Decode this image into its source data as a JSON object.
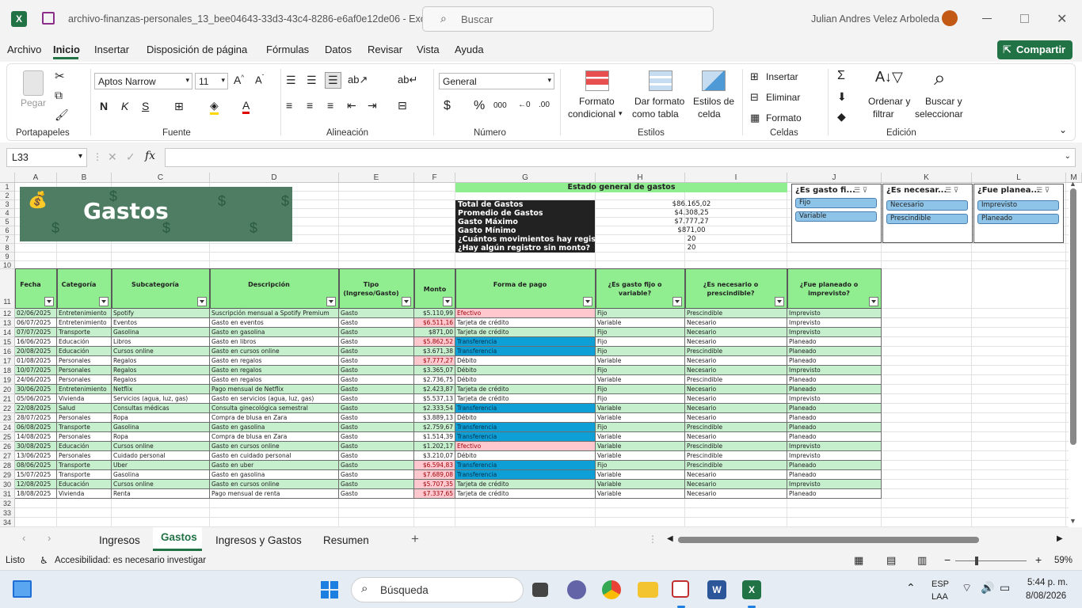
{
  "window": {
    "title": "archivo-finanzas-personales_13_bee04643-33d3-43c4-8286-e6af0e12de06  -  Excel",
    "search_placeholder": "Buscar",
    "user": "Julian Andres Velez Arboleda"
  },
  "menu": [
    "Archivo",
    "Inicio",
    "Insertar",
    "Disposición de página",
    "Fórmulas",
    "Datos",
    "Revisar",
    "Vista",
    "Ayuda"
  ],
  "share_label": "Compartir",
  "ribbon": {
    "groups": [
      "Portapapeles",
      "Fuente",
      "Alineación",
      "Número",
      "Estilos",
      "Celdas",
      "Edición"
    ],
    "paste_label": "Pegar",
    "font_name": "Aptos Narrow",
    "font_size": "11",
    "number_format": "General",
    "cond_format": [
      "Formato",
      "condicional"
    ],
    "format_table": [
      "Dar formato",
      "como tabla"
    ],
    "cell_styles": [
      "Estilos de",
      "celda"
    ],
    "insert": "Insertar",
    "delete": "Eliminar",
    "format": "Formato",
    "sort_filter": [
      "Ordenar y",
      "filtrar"
    ],
    "find_select": [
      "Buscar y",
      "seleccionar"
    ]
  },
  "formula_bar": {
    "name_box": "L33",
    "formula": ""
  },
  "columns": [
    "A",
    "B",
    "C",
    "D",
    "E",
    "F",
    "G",
    "H",
    "I",
    "J",
    "K",
    "L",
    "M"
  ],
  "rows": [
    "1",
    "2",
    "3",
    "4",
    "5",
    "6",
    "7",
    "8",
    "9",
    "10",
    "11",
    "12",
    "13",
    "14",
    "15",
    "16",
    "17",
    "18",
    "19",
    "20",
    "21",
    "22",
    "23",
    "24",
    "25",
    "26",
    "27",
    "28",
    "29",
    "30",
    "31",
    "32",
    "33",
    "34"
  ],
  "banner_title": "Gastos",
  "summary": {
    "title": "Estado general de gastos",
    "labels": [
      "Total de Gastos",
      "Promedio de Gastos",
      "Gasto Máximo",
      "Gasto Mínimo",
      "¿Cuántos movimientos hay registr",
      "¿Hay algún registro sin monto?"
    ],
    "values": [
      "$86.165,02",
      "$4.308,25",
      "$7.777,27",
      "$871,00",
      "20",
      "20"
    ]
  },
  "slicers": [
    {
      "title": "¿Es gasto fi...",
      "items": [
        "Fijo",
        "Variable"
      ]
    },
    {
      "title": "¿Es necesar...",
      "items": [
        "Necesario",
        "Prescindible"
      ]
    },
    {
      "title": "¿Fue planea...",
      "items": [
        "Imprevisto",
        "Planeado"
      ]
    }
  ],
  "table": {
    "headers": [
      "Fecha",
      "Categoría",
      "Subcategoría",
      "Descripción",
      "Tipo (Ingreso/Gasto)",
      "Monto",
      "Forma de pago",
      "¿Es gasto fijo o variable?",
      "¿Es necesario o prescindible?",
      "¿Fue planeado o imprevisto?"
    ],
    "rows": [
      [
        "02/06/2025",
        "Entretenimiento",
        "Spotify",
        "Suscripción mensual a Spotify Premium",
        "Gasto",
        "$5.110,99",
        "Efectivo",
        "Fijo",
        "Prescindible",
        "Imprevisto"
      ],
      [
        "06/07/2025",
        "Entretenimiento",
        "Eventos",
        "Gasto en eventos",
        "Gasto",
        "$6.511,16",
        "Tarjeta de crédito",
        "Variable",
        "Necesario",
        "Imprevisto"
      ],
      [
        "07/07/2025",
        "Transporte",
        "Gasolina",
        "Gasto en gasolina",
        "Gasto",
        "$871,00",
        "Tarjeta de crédito",
        "Fijo",
        "Necesario",
        "Imprevisto"
      ],
      [
        "16/06/2025",
        "Educación",
        "Libros",
        "Gasto en libros",
        "Gasto",
        "$5.862,52",
        "Transferencia",
        "Fijo",
        "Necesario",
        "Planeado"
      ],
      [
        "20/08/2025",
        "Educación",
        "Cursos online",
        "Gasto en cursos online",
        "Gasto",
        "$3.671,38",
        "Transferencia",
        "Fijo",
        "Prescindible",
        "Planeado"
      ],
      [
        "01/08/2025",
        "Personales",
        "Regalos",
        "Gasto en regalos",
        "Gasto",
        "$7.777,27",
        "Débito",
        "Variable",
        "Necesario",
        "Planeado"
      ],
      [
        "10/07/2025",
        "Personales",
        "Regalos",
        "Gasto en regalos",
        "Gasto",
        "$3.365,07",
        "Débito",
        "Fijo",
        "Necesario",
        "Imprevisto"
      ],
      [
        "24/06/2025",
        "Personales",
        "Regalos",
        "Gasto en regalos",
        "Gasto",
        "$2.736,75",
        "Débito",
        "Variable",
        "Prescindible",
        "Planeado"
      ],
      [
        "30/06/2025",
        "Entretenimiento",
        "Netflix",
        "Pago mensual de Netflix",
        "Gasto",
        "$2.423,87",
        "Tarjeta de crédito",
        "Fijo",
        "Necesario",
        "Planeado"
      ],
      [
        "05/06/2025",
        "Vivienda",
        "Servicios (agua, luz, gas)",
        "Gasto en servicios (agua, luz, gas)",
        "Gasto",
        "$5.537,13",
        "Tarjeta de crédito",
        "Fijo",
        "Necesario",
        "Imprevisto"
      ],
      [
        "22/08/2025",
        "Salud",
        "Consultas médicas",
        "Consulta ginecológica semestral",
        "Gasto",
        "$2.333,54",
        "Transferencia",
        "Variable",
        "Necesario",
        "Planeado"
      ],
      [
        "28/07/2025",
        "Personales",
        "Ropa",
        "Compra de blusa en Zara",
        "Gasto",
        "$3.889,13",
        "Débito",
        "Variable",
        "Necesario",
        "Planeado"
      ],
      [
        "06/08/2025",
        "Transporte",
        "Gasolina",
        "Gasto en gasolina",
        "Gasto",
        "$2.759,67",
        "Transferencia",
        "Fijo",
        "Prescindible",
        "Planeado"
      ],
      [
        "14/08/2025",
        "Personales",
        "Ropa",
        "Compra de blusa en Zara",
        "Gasto",
        "$1.514,39",
        "Transferencia",
        "Variable",
        "Necesario",
        "Planeado"
      ],
      [
        "30/08/2025",
        "Educación",
        "Cursos online",
        "Gasto en cursos online",
        "Gasto",
        "$1.202,17",
        "Efectivo",
        "Variable",
        "Prescindible",
        "Imprevisto"
      ],
      [
        "13/06/2025",
        "Personales",
        "Cuidado personal",
        "Gasto en cuidado personal",
        "Gasto",
        "$3.210,07",
        "Débito",
        "Variable",
        "Prescindible",
        "Imprevisto"
      ],
      [
        "08/06/2025",
        "Transporte",
        "Uber",
        "Gasto en uber",
        "Gasto",
        "$6.594,83",
        "Transferencia",
        "Fijo",
        "Prescindible",
        "Planeado"
      ],
      [
        "15/07/2025",
        "Transporte",
        "Gasolina",
        "Gasto en gasolina",
        "Gasto",
        "$7.689,08",
        "Transferencia",
        "Variable",
        "Necesario",
        "Planeado"
      ],
      [
        "12/08/2025",
        "Educación",
        "Cursos online",
        "Gasto en cursos online",
        "Gasto",
        "$5.707,35",
        "Tarjeta de crédito",
        "Variable",
        "Necesario",
        "Imprevisto"
      ],
      [
        "18/08/2025",
        "Vivienda",
        "Renta",
        "Pago mensual de renta",
        "Gasto",
        "$7.337,65",
        "Tarjeta de crédito",
        "Variable",
        "Necesario",
        "Planeado"
      ]
    ]
  },
  "colors": {
    "header_green": "#90ee90",
    "row_green": "#c6efce",
    "pink": "#ffc7ce",
    "blue": "#0e9fd6",
    "excel_green": "#217346"
  },
  "sheets": [
    "Ingresos",
    "Gastos",
    "Ingresos y Gastos",
    "Resumen"
  ],
  "active_sheet": "Gastos",
  "status": {
    "ready": "Listo",
    "accessibility": "Accesibilidad: es necesario investigar",
    "zoom": "59%"
  },
  "taskbar": {
    "search": "Búsqueda",
    "lang1": "ESP",
    "lang2": "LAA",
    "time": "5:44 p. m.",
    "date": "8/08/2026"
  }
}
